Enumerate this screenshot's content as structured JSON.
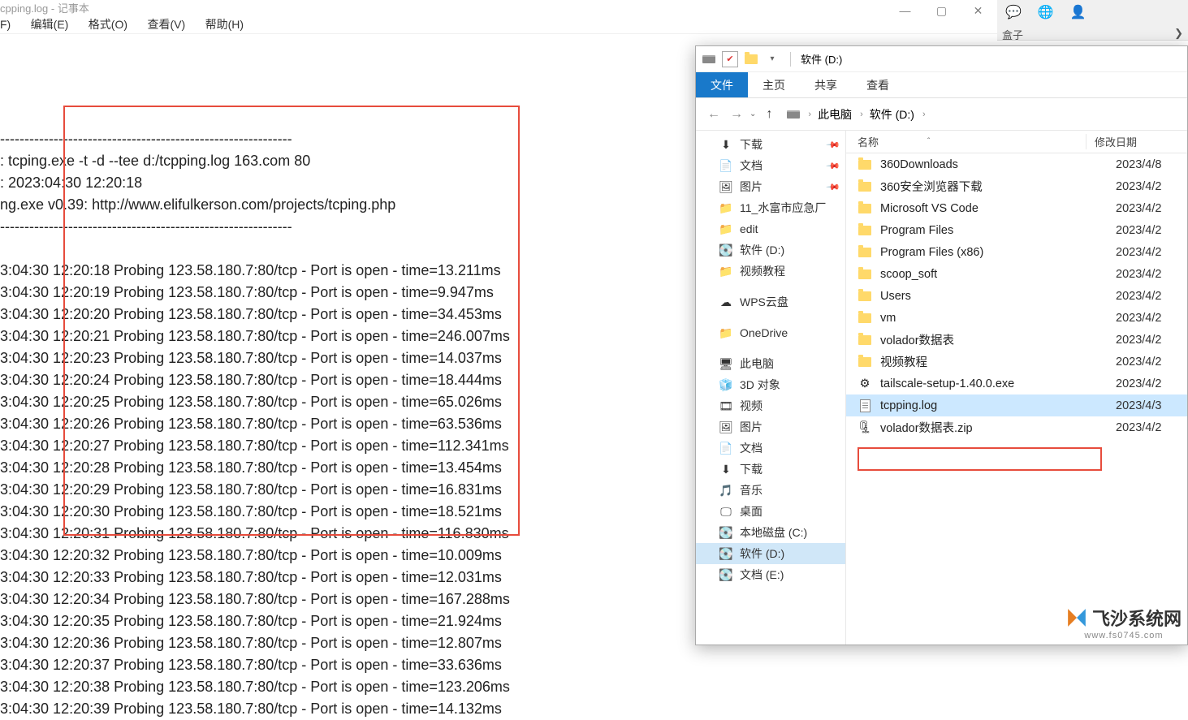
{
  "notepad": {
    "title": "cpping.log - 记事本",
    "menu": [
      "F)",
      "编辑(E)",
      "格式(O)",
      "查看(V)",
      "帮助(H)"
    ],
    "lines": [
      "",
      "------------------------------------------------------------",
      ": tcping.exe -t -d --tee d:/tcpping.log 163.com 80",
      ": 2023:04:30 12:20:18",
      "ng.exe v0.39: http://www.elifulkerson.com/projects/tcping.php",
      "------------------------------------------------------------",
      "",
      "3:04:30 12:20:18 Probing 123.58.180.7:80/tcp - Port is open - time=13.211ms",
      "3:04:30 12:20:19 Probing 123.58.180.7:80/tcp - Port is open - time=9.947ms",
      "3:04:30 12:20:20 Probing 123.58.180.7:80/tcp - Port is open - time=34.453ms",
      "3:04:30 12:20:21 Probing 123.58.180.7:80/tcp - Port is open - time=246.007ms",
      "3:04:30 12:20:23 Probing 123.58.180.7:80/tcp - Port is open - time=14.037ms",
      "3:04:30 12:20:24 Probing 123.58.180.7:80/tcp - Port is open - time=18.444ms",
      "3:04:30 12:20:25 Probing 123.58.180.7:80/tcp - Port is open - time=65.026ms",
      "3:04:30 12:20:26 Probing 123.58.180.7:80/tcp - Port is open - time=63.536ms",
      "3:04:30 12:20:27 Probing 123.58.180.7:80/tcp - Port is open - time=112.341ms",
      "3:04:30 12:20:28 Probing 123.58.180.7:80/tcp - Port is open - time=13.454ms",
      "3:04:30 12:20:29 Probing 123.58.180.7:80/tcp - Port is open - time=16.831ms",
      "3:04:30 12:20:30 Probing 123.58.180.7:80/tcp - Port is open - time=18.521ms",
      "3:04:30 12:20:31 Probing 123.58.180.7:80/tcp - Port is open - time=116.830ms",
      "3:04:30 12:20:32 Probing 123.58.180.7:80/tcp - Port is open - time=10.009ms",
      "3:04:30 12:20:33 Probing 123.58.180.7:80/tcp - Port is open - time=12.031ms",
      "3:04:30 12:20:34 Probing 123.58.180.7:80/tcp - Port is open - time=167.288ms",
      "3:04:30 12:20:35 Probing 123.58.180.7:80/tcp - Port is open - time=21.924ms",
      "3:04:30 12:20:36 Probing 123.58.180.7:80/tcp - Port is open - time=12.807ms",
      "3:04:30 12:20:37 Probing 123.58.180.7:80/tcp - Port is open - time=33.636ms",
      "3:04:30 12:20:38 Probing 123.58.180.7:80/tcp - Port is open - time=123.206ms",
      "3:04:30 12:20:39 Probing 123.58.180.7:80/tcp - Port is open - time=14.132ms"
    ]
  },
  "browser_bar": {
    "tab_label": "盒子",
    "chevron": "❯"
  },
  "explorer": {
    "title": "软件 (D:)",
    "ribbon": [
      "文件",
      "主页",
      "共享",
      "查看"
    ],
    "nav": {
      "back": "←",
      "forward": "→",
      "up": "↑",
      "dropdown": "⌄"
    },
    "breadcrumb": [
      "此电脑",
      "软件 (D:)"
    ],
    "columns": {
      "name": "名称",
      "sort": "ˆ",
      "date": "修改日期"
    },
    "sidebar": [
      {
        "icon": "download",
        "label": "下载",
        "pinned": true
      },
      {
        "icon": "doc",
        "label": "文档",
        "pinned": true
      },
      {
        "icon": "pic",
        "label": "图片",
        "pinned": true
      },
      {
        "icon": "folder",
        "label": "11_水富市应急厂"
      },
      {
        "icon": "folder",
        "label": "edit"
      },
      {
        "icon": "drive",
        "label": "软件 (D:)"
      },
      {
        "icon": "folder",
        "label": "视频教程"
      },
      {
        "spacer": true
      },
      {
        "icon": "cloud",
        "label": "WPS云盘"
      },
      {
        "spacer": true
      },
      {
        "icon": "folder",
        "label": "OneDrive"
      },
      {
        "spacer": true
      },
      {
        "icon": "pc",
        "label": "此电脑"
      },
      {
        "icon": "3d",
        "label": "3D 对象"
      },
      {
        "icon": "video",
        "label": "视频"
      },
      {
        "icon": "pic",
        "label": "图片"
      },
      {
        "icon": "doc",
        "label": "文档"
      },
      {
        "icon": "download",
        "label": "下载"
      },
      {
        "icon": "music",
        "label": "音乐"
      },
      {
        "icon": "desktop",
        "label": "桌面"
      },
      {
        "icon": "drive",
        "label": "本地磁盘 (C:)"
      },
      {
        "icon": "drive",
        "label": "软件 (D:)",
        "selected": true
      },
      {
        "icon": "drive",
        "label": "文档 (E:)"
      }
    ],
    "files": [
      {
        "type": "folder",
        "name": "360Downloads",
        "date": "2023/4/8"
      },
      {
        "type": "folder",
        "name": "360安全浏览器下载",
        "date": "2023/4/2"
      },
      {
        "type": "folder",
        "name": "Microsoft VS Code",
        "date": "2023/4/2"
      },
      {
        "type": "folder",
        "name": "Program Files",
        "date": "2023/4/2"
      },
      {
        "type": "folder",
        "name": "Program Files (x86)",
        "date": "2023/4/2"
      },
      {
        "type": "folder",
        "name": "scoop_soft",
        "date": "2023/4/2"
      },
      {
        "type": "folder",
        "name": "Users",
        "date": "2023/4/2"
      },
      {
        "type": "folder",
        "name": "vm",
        "date": "2023/4/2"
      },
      {
        "type": "folder",
        "name": "volador数据表",
        "date": "2023/4/2"
      },
      {
        "type": "folder",
        "name": "视频教程",
        "date": "2023/4/2"
      },
      {
        "type": "exe",
        "name": "tailscale-setup-1.40.0.exe",
        "date": "2023/4/2"
      },
      {
        "type": "log",
        "name": "tcpping.log",
        "date": "2023/4/3",
        "selected": true
      },
      {
        "type": "zip",
        "name": "volador数据表.zip",
        "date": "2023/4/2"
      }
    ]
  },
  "watermark": {
    "main": "飞沙系统网",
    "sub": "www.fs0745.com"
  },
  "icons": {
    "download": "⬇",
    "doc": "📄",
    "pic": "🖼",
    "folder": "📁",
    "drive": "💽",
    "cloud": "☁",
    "pc": "🖥",
    "3d": "🧊",
    "video": "🎞",
    "music": "🎵",
    "desktop": "🖵",
    "exe": "⚙",
    "log": "📄",
    "zip": "🗜",
    "chat": "💬",
    "edge": "🌐",
    "user": "👤"
  }
}
